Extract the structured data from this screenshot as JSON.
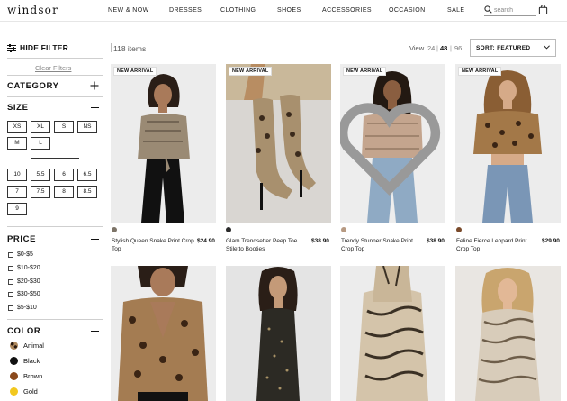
{
  "header": {
    "logo": "windsor",
    "nav": [
      "NEW & NOW",
      "DRESSES",
      "CLOTHING",
      "SHOES",
      "ACCESSORIES",
      "OCCASION",
      "SALE"
    ],
    "search_placeholder": "search"
  },
  "sidebar": {
    "hide_filter": "HIDE FILTER",
    "clear_filters": "Clear Filters",
    "category_title": "CATEGORY",
    "size_title": "SIZE",
    "sizes_alpha": [
      "XS",
      "XL",
      "S",
      "NS",
      "M",
      "L"
    ],
    "sizes_num": [
      "10",
      "5.5",
      "6",
      "6.5",
      "7",
      "7.5",
      "8",
      "8.5",
      "9"
    ],
    "price_title": "PRICE",
    "prices": [
      "$0-$5",
      "$10-$20",
      "$20-$30",
      "$30-$50",
      "$5-$10"
    ],
    "color_title": "COLOR",
    "colors": [
      {
        "name": "Animal",
        "hex": "#7a5a3c"
      },
      {
        "name": "Black",
        "hex": "#111111"
      },
      {
        "name": "Brown",
        "hex": "#8b4a1c"
      },
      {
        "name": "Gold",
        "hex": "#f2c81f"
      }
    ]
  },
  "toolbar": {
    "item_count": "118 items",
    "view_label": "View",
    "view_options": [
      "24",
      "48",
      "96"
    ],
    "view_selected": "48",
    "sort_label": "SORT: FEATURED"
  },
  "products": [
    {
      "badge": "NEW ARRIVAL",
      "name": "Stylish Queen Snake Print Crop Top",
      "price": "$24.90",
      "swatch": "#7d7468"
    },
    {
      "badge": "NEW ARRIVAL",
      "name": "Glam Trendsetter Peep Toe Stiletto Booties",
      "price": "$38.90",
      "swatch": "#2b2b2b"
    },
    {
      "badge": "NEW ARRIVAL",
      "name": "Trendy Stunner Snake Print Crop Top",
      "price": "$38.90",
      "swatch": "#b79a83"
    },
    {
      "badge": "NEW ARRIVAL",
      "name": "Feline Fierce Leopard Print Crop Top",
      "price": "$29.90",
      "swatch": "#7a4a2b"
    },
    {
      "badge": "",
      "name": "",
      "price": "",
      "swatch": ""
    },
    {
      "badge": "",
      "name": "",
      "price": "",
      "swatch": ""
    },
    {
      "badge": "",
      "name": "",
      "price": "",
      "swatch": ""
    },
    {
      "badge": "",
      "name": "",
      "price": "",
      "swatch": ""
    }
  ]
}
